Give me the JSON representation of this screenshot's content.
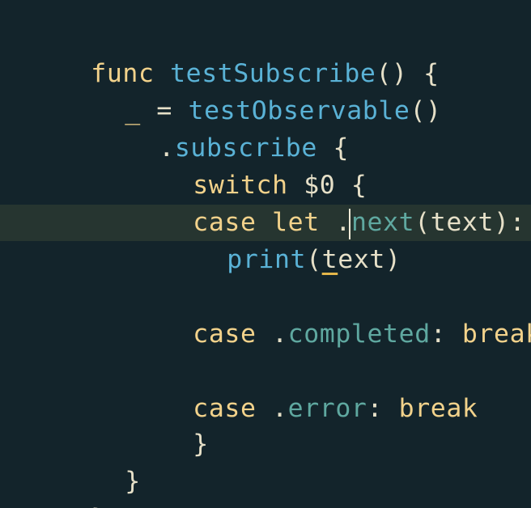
{
  "colors": {
    "background": "#13242b",
    "current_line": "#263530",
    "keyword": "#f2d28b",
    "function": "#5ab2d6",
    "member": "#5fa8a0",
    "plain": "#e6e0c8",
    "warning_underline": "#e3b64a"
  },
  "code": {
    "l1": [
      "func",
      " ",
      "testSubscribe",
      "() {"
    ],
    "l2": [
      "_",
      " = ",
      "testObservable",
      "()"
    ],
    "l3": [
      ".",
      "subscribe",
      " {"
    ],
    "l4": [
      "switch",
      " $0 {"
    ],
    "l5": [
      "case",
      " ",
      "let",
      " .",
      "next",
      "(text):"
    ],
    "l6": [
      "print",
      "(",
      "t",
      "ext)"
    ],
    "l7": [
      "case",
      " .",
      "completed",
      ": ",
      "break"
    ],
    "l8": [
      "case",
      " .",
      "error",
      ": ",
      "break"
    ],
    "l9": [
      "}"
    ],
    "l10": [
      "}"
    ],
    "l11": [
      "}"
    ]
  }
}
